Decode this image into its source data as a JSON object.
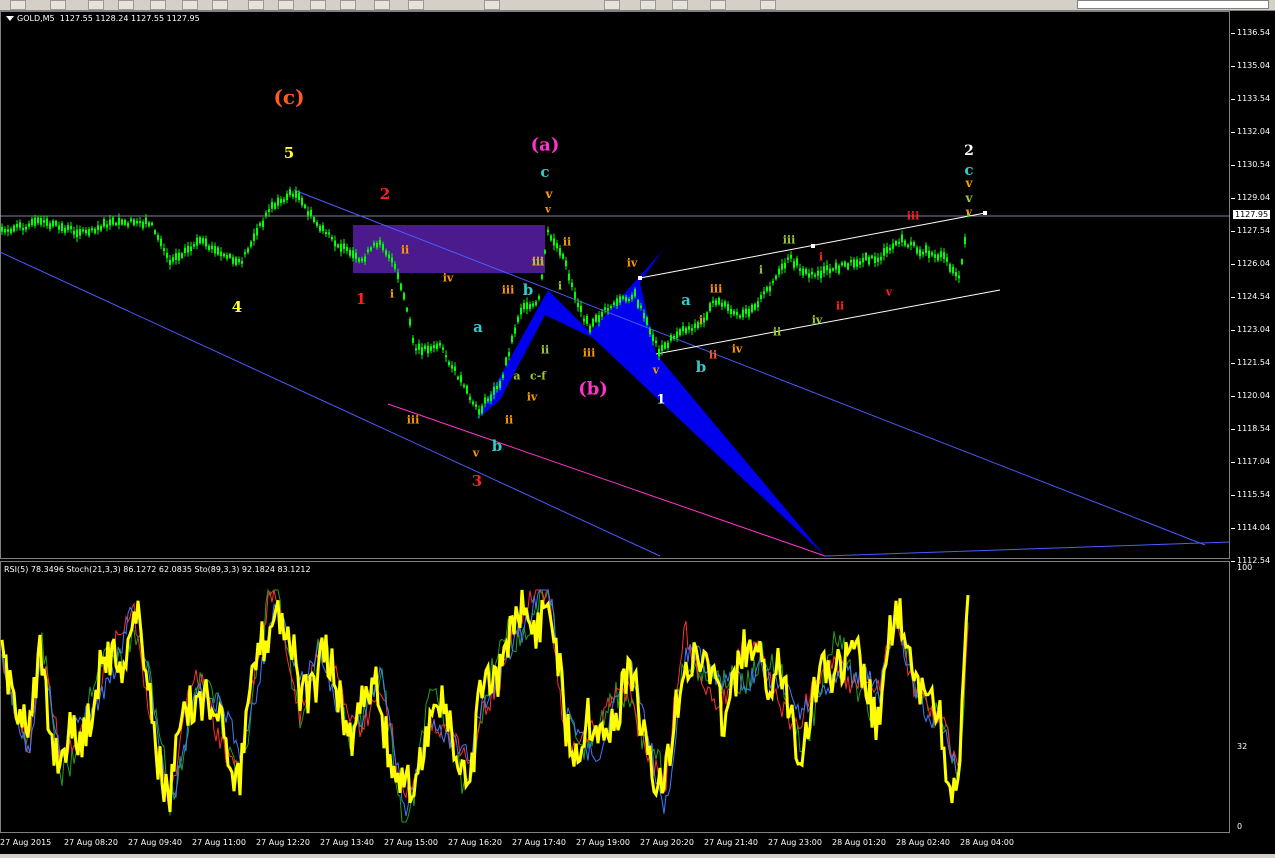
{
  "header": {
    "symbol_label": "GOLD,M5",
    "ohlc": "1127.55 1128.24 1127.55 1127.95"
  },
  "indicator_header": "RSI(5) 78.3496  Stoch(21,3,3) 86.1272 62.0835  Sto(89,3,3) 92.1824 83.1212",
  "price_axis": [
    "1136.54",
    "1135.04",
    "1133.54",
    "1132.04",
    "1130.54",
    "1129.04",
    "1127.54",
    "1126.04",
    "1124.54",
    "1123.04",
    "1121.54",
    "1120.04",
    "1118.54",
    "1117.04",
    "1115.54",
    "1114.04",
    "1112.54"
  ],
  "current_price": "1127.95",
  "indicator_axis": [
    "100",
    "32",
    "0"
  ],
  "time_axis": [
    "27 Aug 2015",
    "27 Aug 08:20",
    "27 Aug 09:40",
    "27 Aug 11:00",
    "27 Aug 12:20",
    "27 Aug 13:40",
    "27 Aug 15:00",
    "27 Aug 16:20",
    "27 Aug 17:40",
    "27 Aug 19:00",
    "27 Aug 20:20",
    "27 Aug 21:40",
    "27 Aug 23:00",
    "28 Aug 01:20",
    "28 Aug 02:40",
    "28 Aug 04:00"
  ],
  "colors": {
    "background": "#000000",
    "candles": "#00ff00",
    "rsi": "#ffff00",
    "stoch_a": "#3c7cff",
    "stoch_b": "#ff3030",
    "stoch_c": "#20a020",
    "channel": "#ffffff",
    "trendline": "#4a5cff",
    "magenta_line": "#ff33cc",
    "harmonic": "#0000ee",
    "box": "#4b1a8c"
  },
  "waves": [
    {
      "text": "(c)",
      "color": "#ff5a1f",
      "size": 20
    },
    {
      "text": "5",
      "color": "#ffff33",
      "size": 15
    },
    {
      "text": "4",
      "color": "#ffff33",
      "size": 15
    },
    {
      "text": "2",
      "color": "#ff2020",
      "size": 15
    },
    {
      "text": "1",
      "color": "#ff2020",
      "size": 15
    },
    {
      "text": "3",
      "color": "#ff2020",
      "size": 15
    },
    {
      "text": "(a)",
      "color": "#ff33cc",
      "size": 18
    },
    {
      "text": "c",
      "color": "#33cccc",
      "size": 15
    },
    {
      "text": "v",
      "color": "#ff9900",
      "size": 12
    },
    {
      "text": "v",
      "color": "#ff9900",
      "size": 10
    },
    {
      "text": "ii",
      "color": "#ff9900",
      "size": 11
    },
    {
      "text": "ii",
      "color": "#ff9900",
      "size": 11
    },
    {
      "text": "iv",
      "color": "#ff9900",
      "size": 11
    },
    {
      "text": "i",
      "color": "#ff9900",
      "size": 11
    },
    {
      "text": "iii",
      "color": "#ff9900",
      "size": 11
    },
    {
      "text": "iii",
      "color": "#ff9900",
      "size": 11
    },
    {
      "text": "iii",
      "color": "#ff9900",
      "size": 11
    },
    {
      "text": "ii",
      "color": "#ff9900",
      "size": 11
    },
    {
      "text": "iv",
      "color": "#ff9900",
      "size": 11
    },
    {
      "text": "v",
      "color": "#ff9900",
      "size": 11
    },
    {
      "text": "a",
      "color": "#33cccc",
      "size": 15
    },
    {
      "text": "b",
      "color": "#33cccc",
      "size": 15
    },
    {
      "text": "b",
      "color": "#33cccc",
      "size": 15
    },
    {
      "text": "a",
      "color": "#99cc33",
      "size": 11
    },
    {
      "text": "c-f",
      "color": "#99cc33",
      "size": 11
    },
    {
      "text": "ii",
      "color": "#99cc33",
      "size": 11
    },
    {
      "text": "i",
      "color": "#99cc33",
      "size": 11
    },
    {
      "text": "iii",
      "color": "#99cc33",
      "size": 10
    },
    {
      "text": "(b)",
      "color": "#ff33cc",
      "size": 18
    },
    {
      "text": "iii",
      "color": "#ff9900",
      "size": 11
    },
    {
      "text": "iv",
      "color": "#ff9900",
      "size": 11
    },
    {
      "text": "v",
      "color": "#ff9900",
      "size": 11
    },
    {
      "text": "1",
      "color": "#ffffff",
      "size": 13
    },
    {
      "text": "a",
      "color": "#33cccc",
      "size": 15
    },
    {
      "text": "b",
      "color": "#33cccc",
      "size": 15
    },
    {
      "text": "i",
      "color": "#ff9900",
      "size": 11
    },
    {
      "text": "ii",
      "color": "#ff5a1f",
      "size": 11
    },
    {
      "text": "iii",
      "color": "#ff9900",
      "size": 11
    },
    {
      "text": "iv",
      "color": "#ff9900",
      "size": 11
    },
    {
      "text": "iii",
      "color": "#99cc33",
      "size": 11
    },
    {
      "text": "i",
      "color": "#99cc33",
      "size": 11
    },
    {
      "text": "ii",
      "color": "#99cc33",
      "size": 11
    },
    {
      "text": "iv",
      "color": "#99cc33",
      "size": 11
    },
    {
      "text": "i",
      "color": "#ff2020",
      "size": 11
    },
    {
      "text": "ii",
      "color": "#ff2020",
      "size": 11
    },
    {
      "text": "v",
      "color": "#ff2020",
      "size": 11
    },
    {
      "text": "iii",
      "color": "#ff2020",
      "size": 11
    },
    {
      "text": "2",
      "color": "#ffffff",
      "size": 14
    },
    {
      "text": "c",
      "color": "#33cccc",
      "size": 15
    },
    {
      "text": "v",
      "color": "#ff9900",
      "size": 12
    },
    {
      "text": "v",
      "color": "#99cc33",
      "size": 12
    },
    {
      "text": "v",
      "color": "#ff9900",
      "size": 11
    }
  ]
}
